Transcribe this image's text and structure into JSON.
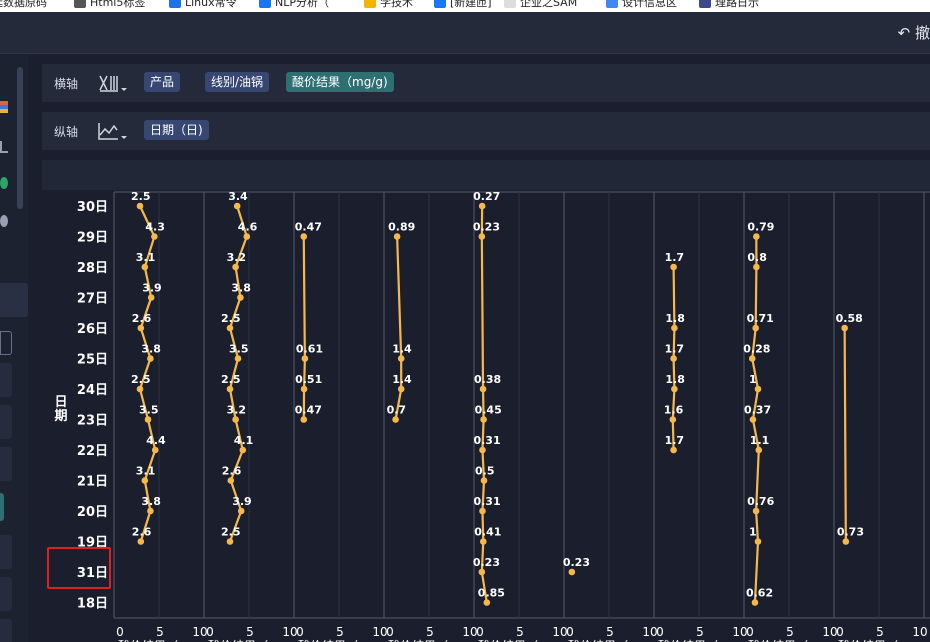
{
  "bookmarks": [
    {
      "label": "延数据原码",
      "x": -8,
      "color": ""
    },
    {
      "label": "Html5标签",
      "x": 90,
      "color": "#555"
    },
    {
      "label": "Linux常令",
      "x": 185,
      "color": "#1a73e8"
    },
    {
      "label": "NLP分析（",
      "x": 275,
      "color": "#1877f2"
    },
    {
      "label": "学技术",
      "x": 380,
      "color": "#f4b400"
    },
    {
      "label": "[新建匝]",
      "x": 450,
      "color": "#1877f2"
    },
    {
      "label": "企业之SAM",
      "x": 520,
      "color": "#ddd"
    },
    {
      "label": "设计信息区",
      "x": 622,
      "color": "#4285f4"
    },
    {
      "label": "理路日示",
      "x": 715,
      "color": "#3a4a8a"
    }
  ],
  "top_right_label": "撤",
  "shelves": {
    "x_axis": {
      "label": "横轴",
      "icon": "column-chart-icon",
      "pills": [
        {
          "label": "产品",
          "style": "blue"
        },
        {
          "label": "线别/油锅",
          "style": "blue"
        },
        {
          "label": "酸价结果（mg/g)",
          "style": "teal"
        }
      ]
    },
    "y_axis": {
      "label": "纵轴",
      "icon": "area-chart-icon",
      "pills": [
        {
          "label": "日期（日)",
          "style": "blue"
        }
      ]
    }
  },
  "colors": {
    "background": "#1b1f2d",
    "panel": "#252a3a",
    "pill_blue": "#374772",
    "pill_teal": "#2e6f73",
    "line": "#f6b84b",
    "grid": "#555b6e",
    "highlight": "#e02020"
  },
  "chart_data": {
    "type": "line",
    "orientation": "vertical-categories",
    "ylabel": "日期",
    "categories": [
      "30日",
      "29日",
      "28日",
      "27日",
      "26日",
      "25日",
      "24日",
      "23日",
      "22日",
      "21日",
      "20日",
      "19日",
      "31日",
      "18日"
    ],
    "xlim": [
      0,
      10
    ],
    "x_ticks": [
      0,
      5,
      10
    ],
    "x_axis_title": "酸价结果（m",
    "highlighted_category": "31日",
    "panels": [
      {
        "values": [
          2.5,
          4.3,
          3.1,
          3.9,
          2.6,
          3.8,
          2.5,
          3.5,
          4.4,
          3.1,
          3.8,
          2.6,
          null,
          null
        ]
      },
      {
        "values": [
          3.4,
          4.6,
          3.2,
          3.8,
          2.5,
          3.5,
          2.5,
          3.2,
          4.1,
          2.6,
          3.9,
          2.5,
          null,
          null
        ]
      },
      {
        "values": [
          null,
          0.47,
          null,
          null,
          null,
          0.61,
          0.51,
          0.47,
          null,
          null,
          null,
          null,
          null,
          null
        ]
      },
      {
        "values": [
          null,
          0.89,
          null,
          null,
          null,
          1.4,
          1.4,
          0.7,
          null,
          null,
          null,
          null,
          null,
          null
        ]
      },
      {
        "values": [
          0.27,
          0.23,
          null,
          null,
          null,
          null,
          0.38,
          0.45,
          0.31,
          0.5,
          0.31,
          0.41,
          0.23,
          0.85
        ]
      },
      {
        "values": [
          null,
          null,
          null,
          null,
          null,
          null,
          null,
          null,
          null,
          null,
          null,
          null,
          0.23,
          null
        ]
      },
      {
        "values": [
          null,
          null,
          1.7,
          null,
          1.8,
          1.7,
          1.8,
          1.6,
          1.7,
          null,
          null,
          null,
          null,
          null
        ]
      },
      {
        "values": [
          null,
          0.79,
          0.8,
          null,
          0.71,
          0.28,
          1,
          0.37,
          1.1,
          null,
          0.76,
          1,
          null,
          0.62
        ]
      },
      {
        "values": [
          null,
          null,
          null,
          null,
          0.58,
          null,
          null,
          null,
          null,
          null,
          null,
          0.73,
          null,
          null
        ]
      }
    ]
  }
}
